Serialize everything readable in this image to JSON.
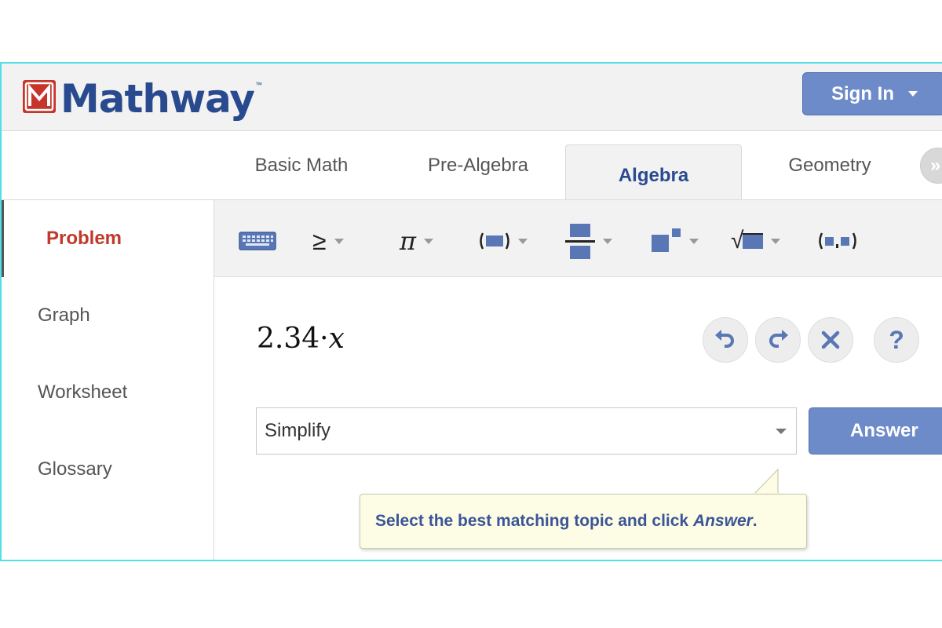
{
  "header": {
    "logo_text": "Mathway",
    "logo_tm": "™",
    "signin_label": "Sign In"
  },
  "tabs": [
    {
      "label": "Basic Math",
      "active": false
    },
    {
      "label": "Pre-Algebra",
      "active": false
    },
    {
      "label": "Algebra",
      "active": true
    },
    {
      "label": "Geometry",
      "active": false
    }
  ],
  "sidebar": {
    "items": [
      {
        "label": "Problem",
        "active": true
      },
      {
        "label": "Graph"
      },
      {
        "label": "Worksheet"
      },
      {
        "label": "Glossary"
      }
    ]
  },
  "toolbar": {
    "gte_symbol": "≥",
    "pi_symbol": "π",
    "sqrt_symbol": "√"
  },
  "work": {
    "expression_number": "2.34",
    "expression_dot": "·",
    "expression_var": "x",
    "help_symbol": "?",
    "topic_selected": "Simplify",
    "answer_label": "Answer"
  },
  "tooltip": {
    "text_before": "Select the best matching topic and click ",
    "text_em": "Answer",
    "text_after": "."
  },
  "colors": {
    "brand_blue": "#294a8e",
    "brand_red": "#c6342b",
    "button_blue": "#6d8bc8",
    "active_red": "#c0392b",
    "tooltip_bg": "#fdfde6",
    "frame_cyan": "#4fe0e8"
  }
}
